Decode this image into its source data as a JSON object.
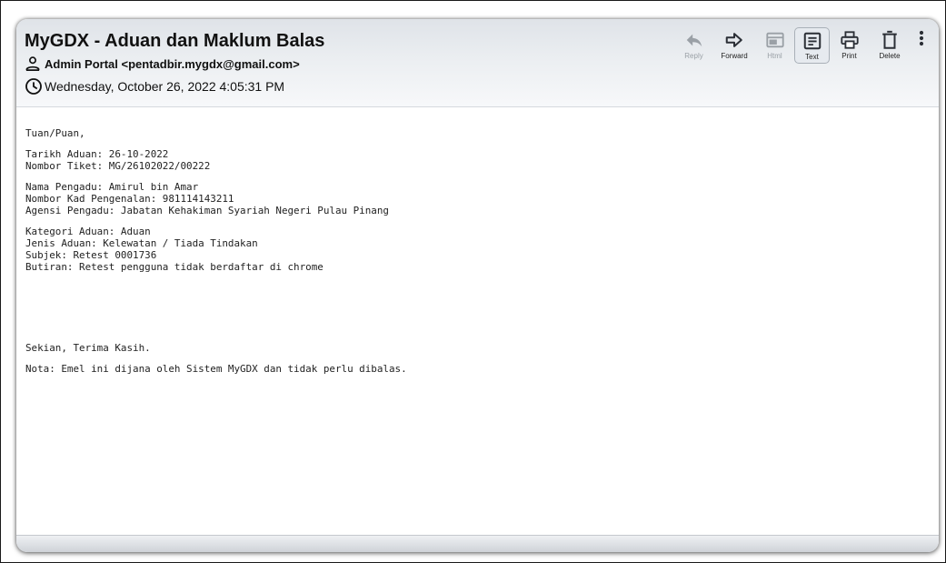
{
  "message": {
    "subject": "MyGDX - Aduan dan Maklum Balas",
    "from": "Admin Portal <pentadbir.mygdx@gmail.com>",
    "date": "Wednesday, October 26, 2022 4:05:31 PM",
    "from_icon": "person-icon",
    "date_icon": "clock-icon"
  },
  "toolbar": {
    "reply": {
      "label": "Reply",
      "icon": "reply-icon",
      "enabled": false
    },
    "forward": {
      "label": "Forward",
      "icon": "forward-icon",
      "enabled": true
    },
    "html": {
      "label": "Html",
      "icon": "html-view-icon",
      "enabled": false
    },
    "text": {
      "label": "Text",
      "icon": "text-view-icon",
      "enabled": true,
      "selected": true
    },
    "print": {
      "label": "Print",
      "icon": "printer-icon",
      "enabled": true
    },
    "delete": {
      "label": "Delete",
      "icon": "trash-icon",
      "enabled": true
    },
    "more": {
      "icon": "more-vertical-icon"
    }
  },
  "body": {
    "greeting": "Tuan/Puan,",
    "tarikh_aduan": "Tarikh Aduan: 26-10-2022",
    "nombor_tiket": "Nombor Tiket: MG/26102022/00222",
    "nama_pengadu": "Nama Pengadu: Amirul bin Amar",
    "nombor_kad": "Nombor Kad Pengenalan: 981114143211",
    "agensi": "Agensi Pengadu: Jabatan Kehakiman Syariah Negeri Pulau Pinang",
    "kategori": "Kategori Aduan: Aduan",
    "jenis": "Jenis Aduan: Kelewatan / Tiada Tindakan",
    "subjek": "Subjek: Retest 0001736",
    "butiran": "Butiran: Retest pengguna tidak berdaftar di chrome",
    "closing": "Sekian, Terima Kasih.",
    "nota": "Nota: Emel ini dijana oleh Sistem MyGDX dan tidak perlu dibalas."
  },
  "colors": {
    "header_gradient_top": "#dfe3e8",
    "header_gradient_bottom": "#f7f8fa",
    "text": "#111111",
    "disabled": "#9aa0a6",
    "icon": "#2b2f36"
  }
}
